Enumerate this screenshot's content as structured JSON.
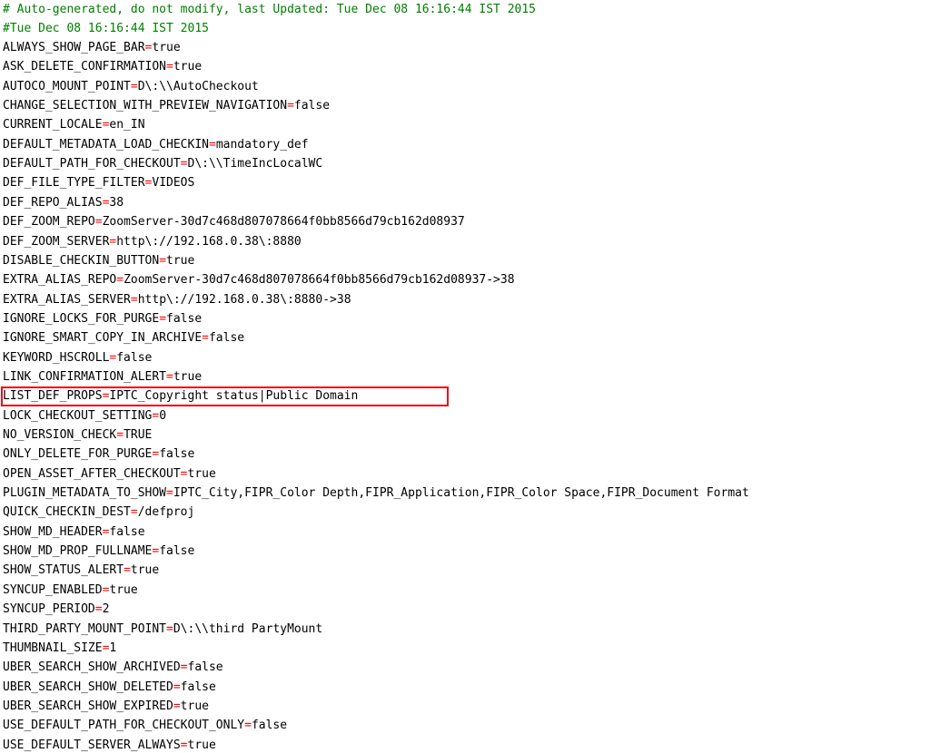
{
  "comments": [
    "# Auto-generated, do not modify, last Updated: Tue Dec 08 16:16:44 IST 2015",
    "#Tue Dec 08 16:16:44 IST 2015"
  ],
  "entries": [
    {
      "key": "ALWAYS_SHOW_PAGE_BAR",
      "value": "true"
    },
    {
      "key": "ASK_DELETE_CONFIRMATION",
      "value": "true"
    },
    {
      "key": "AUTOCO_MOUNT_POINT",
      "value": "D\\:\\\\AutoCheckout"
    },
    {
      "key": "CHANGE_SELECTION_WITH_PREVIEW_NAVIGATION",
      "value": "false"
    },
    {
      "key": "CURRENT_LOCALE",
      "value": "en_IN"
    },
    {
      "key": "DEFAULT_METADATA_LOAD_CHECKIN",
      "value": "mandatory_def"
    },
    {
      "key": "DEFAULT_PATH_FOR_CHECKOUT",
      "value": "D\\:\\\\TimeIncLocalWC"
    },
    {
      "key": "DEF_FILE_TYPE_FILTER",
      "value": "VIDEOS"
    },
    {
      "key": "DEF_REPO_ALIAS",
      "value": "38"
    },
    {
      "key": "DEF_ZOOM_REPO",
      "value": "ZoomServer-30d7c468d807078664f0bb8566d79cb162d08937"
    },
    {
      "key": "DEF_ZOOM_SERVER",
      "value": "http\\://192.168.0.38\\:8880"
    },
    {
      "key": "DISABLE_CHECKIN_BUTTON",
      "value": "true"
    },
    {
      "key": "EXTRA_ALIAS_REPO",
      "value": "ZoomServer-30d7c468d807078664f0bb8566d79cb162d08937->38"
    },
    {
      "key": "EXTRA_ALIAS_SERVER",
      "value": "http\\://192.168.0.38\\:8880->38"
    },
    {
      "key": "IGNORE_LOCKS_FOR_PURGE",
      "value": "false"
    },
    {
      "key": "IGNORE_SMART_COPY_IN_ARCHIVE",
      "value": "false"
    },
    {
      "key": "KEYWORD_HSCROLL",
      "value": "false"
    },
    {
      "key": "LINK_CONFIRMATION_ALERT",
      "value": "true"
    },
    {
      "key": "LIST_DEF_PROPS",
      "value": "IPTC_Copyright status|Public Domain",
      "highlighted": true
    },
    {
      "key": "LOCK_CHECKOUT_SETTING",
      "value": "0"
    },
    {
      "key": "NO_VERSION_CHECK",
      "value": "TRUE"
    },
    {
      "key": "ONLY_DELETE_FOR_PURGE",
      "value": "false"
    },
    {
      "key": "OPEN_ASSET_AFTER_CHECKOUT",
      "value": "true"
    },
    {
      "key": "PLUGIN_METADATA_TO_SHOW",
      "value": "IPTC_City,FIPR_Color Depth,FIPR_Application,FIPR_Color Space,FIPR_Document Format"
    },
    {
      "key": "QUICK_CHECKIN_DEST",
      "value": "/defproj"
    },
    {
      "key": "SHOW_MD_HEADER",
      "value": "false"
    },
    {
      "key": "SHOW_MD_PROP_FULLNAME",
      "value": "false"
    },
    {
      "key": "SHOW_STATUS_ALERT",
      "value": "true"
    },
    {
      "key": "SYNCUP_ENABLED",
      "value": "true"
    },
    {
      "key": "SYNCUP_PERIOD",
      "value": "2"
    },
    {
      "key": "THIRD_PARTY_MOUNT_POINT",
      "value": "D\\:\\\\third PartyMount"
    },
    {
      "key": "THUMBNAIL_SIZE",
      "value": "1"
    },
    {
      "key": "UBER_SEARCH_SHOW_ARCHIVED",
      "value": "false"
    },
    {
      "key": "UBER_SEARCH_SHOW_DELETED",
      "value": "false"
    },
    {
      "key": "UBER_SEARCH_SHOW_EXPIRED",
      "value": "true"
    },
    {
      "key": "USE_DEFAULT_PATH_FOR_CHECKOUT_ONLY",
      "value": "false"
    },
    {
      "key": "USE_DEFAULT_SERVER_ALWAYS",
      "value": "true"
    }
  ],
  "separator": "=",
  "colors": {
    "comment": "#008000",
    "separator": "#ff0000",
    "text": "#000000",
    "highlight_border": "#e8101e"
  }
}
